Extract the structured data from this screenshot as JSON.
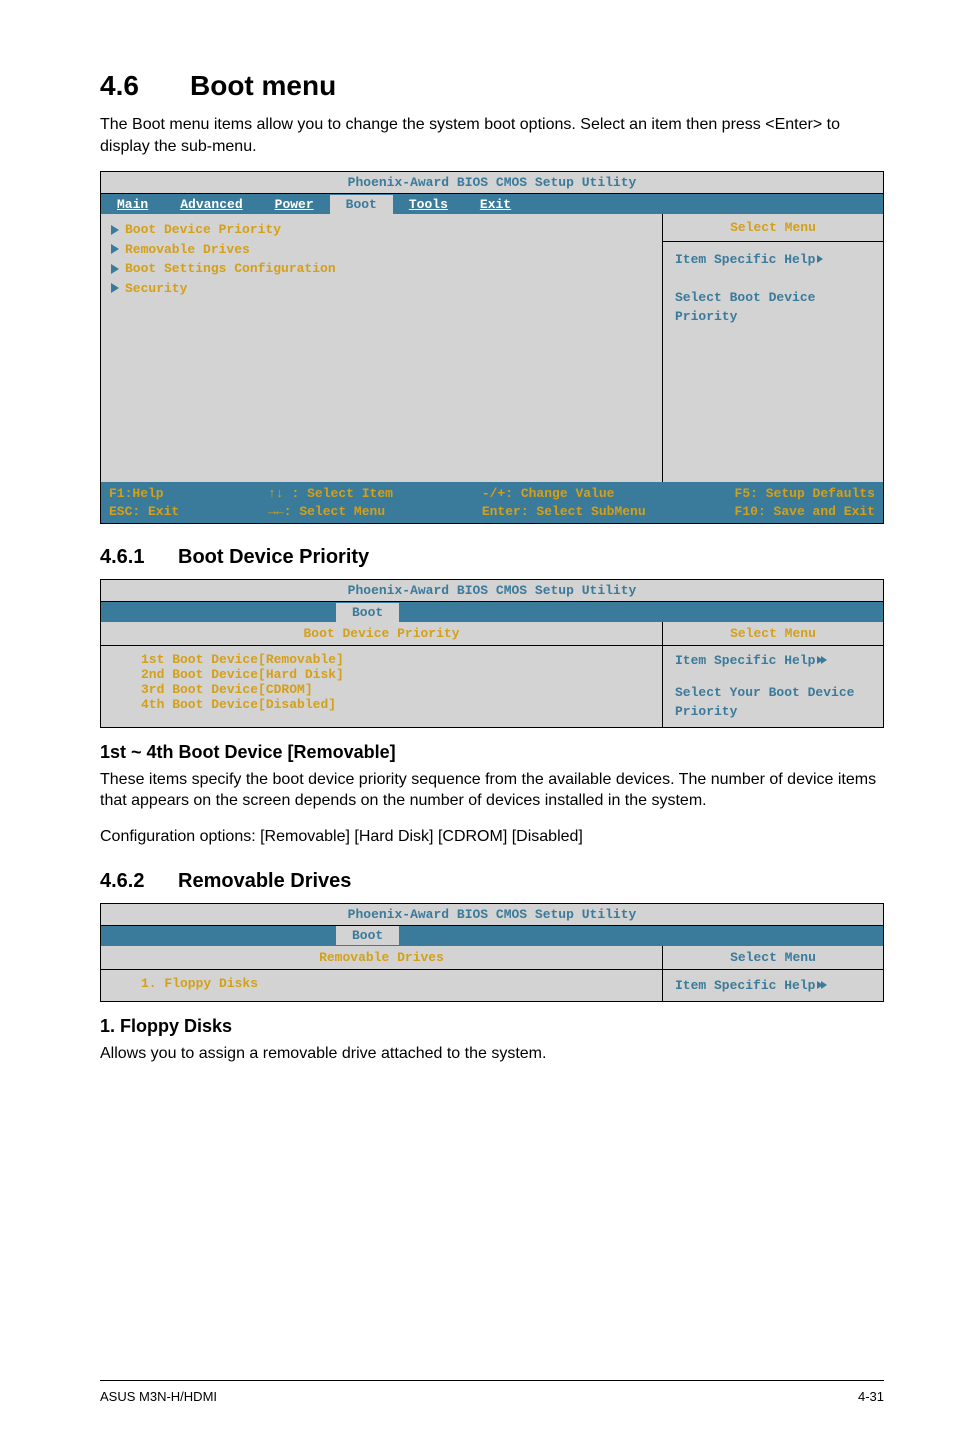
{
  "headings": {
    "h1_num": "4.6",
    "h1_title": "Boot menu",
    "h1_para": "The Boot menu items allow you to change the system boot options. Select an item then press <Enter> to display the sub-menu.",
    "h2a_num": "4.6.1",
    "h2a_title": "Boot Device Priority",
    "h3a": "1st ~ 4th Boot Device [Removable]",
    "h3a_p1": "These items specify the boot device priority sequence from the available devices. The number of device items that appears on the screen depends on the number of devices installed in the system.",
    "h3a_p2": "Configuration options: [Removable] [Hard Disk] [CDROM] [Disabled]",
    "h2b_num": "4.6.2",
    "h2b_title": "Removable Drives",
    "h3b": "1. Floppy Disks",
    "h3b_p": "Allows you to assign a removable drive attached to the system."
  },
  "bios_common": {
    "title": "Phoenix-Award BIOS CMOS Setup Utility",
    "select_menu": "Select Menu",
    "item_help": "Item Specific Help"
  },
  "bios1": {
    "tabs": [
      "Main",
      "Advanced",
      "Power",
      "Boot",
      "Tools",
      "Exit"
    ],
    "active_tab_index": 3,
    "menu_items": [
      "Boot Device Priority",
      "Removable Drives",
      "Boot Settings Configuration",
      "Security"
    ],
    "right_help": "Select Boot Device Priority",
    "footer": {
      "c1a": "F1:Help",
      "c1b": "ESC: Exit",
      "c2a": "↑↓ : Select Item",
      "c2b": "→←: Select Menu",
      "c3a": "-/+: Change Value",
      "c3b": "Enter: Select SubMenu",
      "c4a": "F5: Setup Defaults",
      "c4b": "F10: Save and Exit"
    }
  },
  "bios2": {
    "tab": "Boot",
    "left_header": "Boot Device Priority",
    "devices": [
      {
        "name": "1st Boot Device",
        "value": "[Removable]"
      },
      {
        "name": "2nd Boot Device",
        "value": "[Hard Disk]"
      },
      {
        "name": "3rd Boot Device",
        "value": "[CDROM]"
      },
      {
        "name": "4th Boot Device",
        "value": "[Disabled]"
      }
    ],
    "right_help": "Select Your Boot Device Priority"
  },
  "bios3": {
    "tab": "Boot",
    "left_header": "Removable Drives",
    "row": "1. Floppy Disks"
  },
  "footer": {
    "left": "ASUS M3N-H/HDMI",
    "right": "4-31"
  }
}
